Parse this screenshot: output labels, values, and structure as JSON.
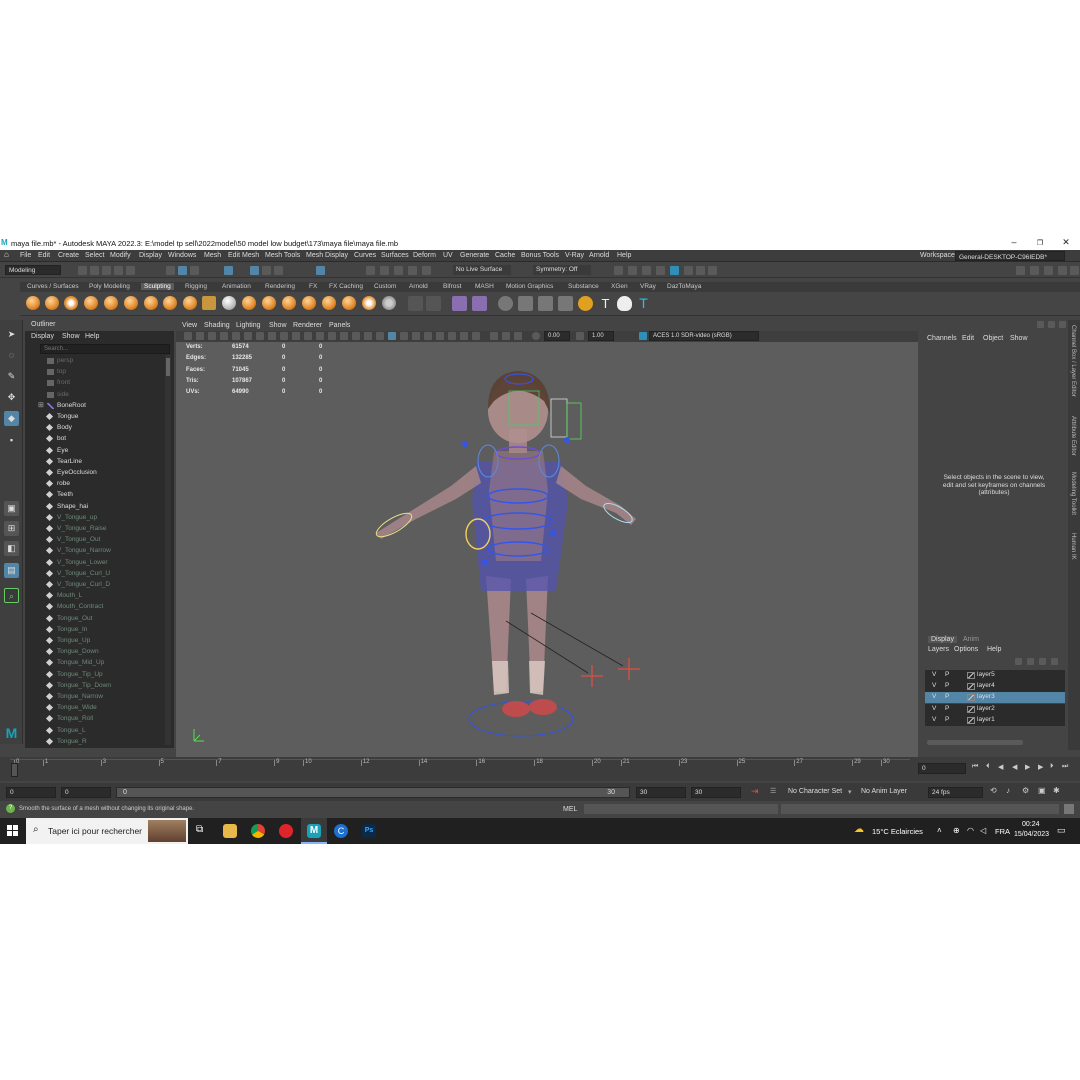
{
  "window": {
    "title": "maya file.mb* - Autodesk MAYA 2022.3: E:\\model tp sell\\2022model\\50 model low budget\\173\\maya file\\maya file.mb"
  },
  "menus": [
    "File",
    "Edit",
    "Create",
    "Select",
    "Modify",
    "Display",
    "Windows",
    "Mesh",
    "Edit Mesh",
    "Mesh Tools",
    "Mesh Display",
    "Curves",
    "Surfaces",
    "Deform",
    "UV",
    "Generate",
    "Cache",
    "Bonus Tools",
    "V-Ray",
    "Arnold",
    "Help"
  ],
  "workspace": {
    "label": "Workspace:",
    "value": "General-DESKTOP-C96IEDB*"
  },
  "toolbar": {
    "mode": "Modeling",
    "live_surface": "No Live Surface",
    "symmetry": "Symmetry: Off"
  },
  "shelf_tabs": [
    "Curves / Surfaces",
    "Poly Modeling",
    "Sculpting",
    "Rigging",
    "Animation",
    "Rendering",
    "FX",
    "FX Caching",
    "Custom",
    "Arnold",
    "Bifrost",
    "MASH",
    "Motion Graphics",
    "Substance",
    "XGen",
    "VRay",
    "DazToMaya"
  ],
  "shelf_active": "Sculpting",
  "outliner": {
    "title": "Outliner",
    "menu": [
      "Display",
      "Show",
      "Help"
    ],
    "search_placeholder": "Search...",
    "items": [
      "persp",
      "top",
      "front",
      "side",
      "BoneRoot",
      "Tongue",
      "Body",
      "bot",
      "Eye",
      "TearLine",
      "EyeOcclusion",
      "robe",
      "Teeth",
      "Shape_hai",
      "V_Tongue_up",
      "V_Tongue_Raise",
      "V_Tongue_Out",
      "V_Tongue_Narrow",
      "V_Tongue_Lower",
      "V_Tongue_Curl_U",
      "V_Tongue_Curl_D",
      "Mouth_L",
      "Mouth_Contract",
      "Tongue_Out",
      "Tongue_In",
      "Tongue_Up",
      "Tongue_Down",
      "Tongue_Mid_Up",
      "Tongue_Tip_Up",
      "Tongue_Tip_Down",
      "Tongue_Narrow",
      "Tongue_Wide",
      "Tongue_Roll",
      "Tongue_L",
      "Tongue_R"
    ]
  },
  "viewport": {
    "menu": [
      "View",
      "Shading",
      "Lighting",
      "Show",
      "Renderer",
      "Panels"
    ],
    "exposure": "0.00",
    "gamma": "1.00",
    "colorspace": "ACES 1.0 SDR-video (sRGB)",
    "hud": [
      {
        "label": "Verts:",
        "v": "61574",
        "a": "0",
        "b": "0"
      },
      {
        "label": "Edges:",
        "v": "132285",
        "a": "0",
        "b": "0"
      },
      {
        "label": "Faces:",
        "v": "71045",
        "a": "0",
        "b": "0"
      },
      {
        "label": "Tris:",
        "v": "107867",
        "a": "0",
        "b": "0"
      },
      {
        "label": "UVs:",
        "v": "64990",
        "a": "0",
        "b": "0"
      }
    ]
  },
  "channel_box": {
    "menu": [
      "Channels",
      "Edit",
      "Object",
      "Show"
    ],
    "hint": "Select objects in the scene to view, edit and set keyframes on channels (attributes)"
  },
  "side_tabs": [
    "Channel Box / Layer Editor",
    "Attribute Editor",
    "Modeling Toolkit",
    "Human IK"
  ],
  "layer_editor": {
    "tabs": [
      "Display",
      "Anim"
    ],
    "menu": [
      "Layers",
      "Options",
      "Help"
    ],
    "layers": [
      {
        "v": "V",
        "p": "P",
        "name": "layer5"
      },
      {
        "v": "V",
        "p": "P",
        "name": "layer4"
      },
      {
        "v": "V",
        "p": "P",
        "name": "layer3"
      },
      {
        "v": "V",
        "p": "P",
        "name": "layer2"
      },
      {
        "v": "V",
        "p": "P",
        "name": "layer1"
      }
    ],
    "selected": "layer3"
  },
  "timeline": {
    "ticks": [
      "0",
      "1",
      "3",
      "5",
      "7",
      "9",
      "10",
      "12",
      "14",
      "16",
      "18",
      "20",
      "21",
      "23",
      "25",
      "27",
      "29",
      "30"
    ],
    "current_frame": "0",
    "range_start": "0",
    "range_start2": "0",
    "range_inner_start": "0",
    "range_inner_end": "30",
    "range_end": "30",
    "range_end2": "30",
    "character_set": "No Character Set",
    "anim_layer": "No Anim Layer",
    "fps": "24 fps"
  },
  "command_line": {
    "label": "MEL"
  },
  "status_line": "Smooth the surface of a mesh without changing its original shape.",
  "taskbar": {
    "search_placeholder": "Taper ici pour rechercher",
    "weather": "15°C  Eclaircies",
    "language": "FRA",
    "time": "00:24",
    "date": "15/04/2023"
  }
}
